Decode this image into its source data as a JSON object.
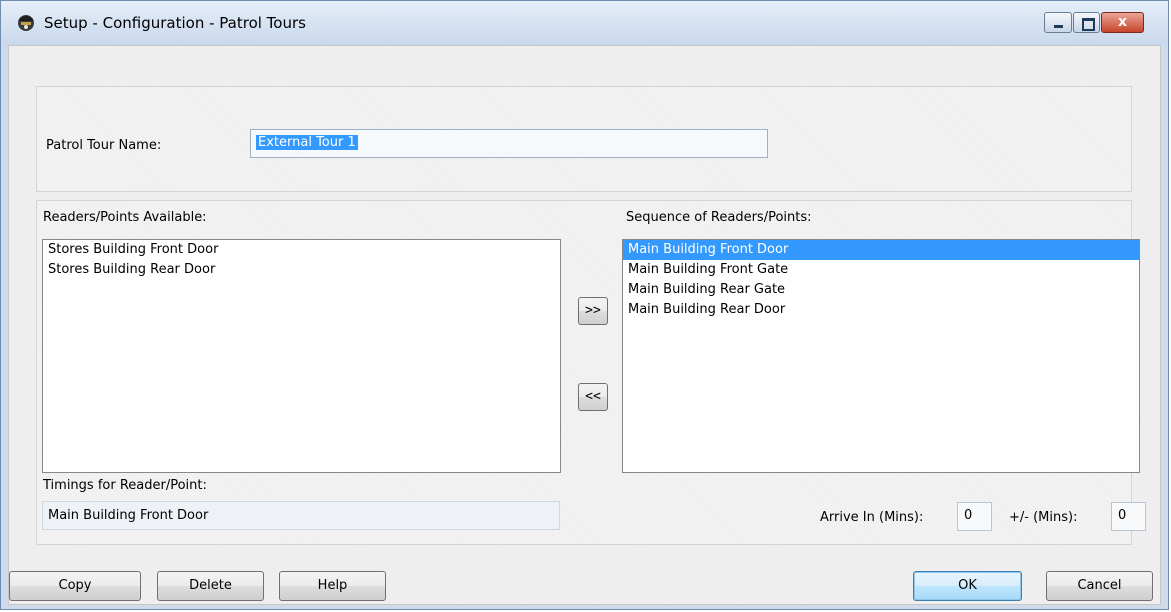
{
  "window": {
    "title": "Setup - Configuration - Patrol Tours",
    "close_glyph": "x"
  },
  "tour": {
    "name_label": "Patrol Tour Name:",
    "name_value": "External Tour 1"
  },
  "available": {
    "label": "Readers/Points Available:",
    "items": [
      "Stores Building Front Door",
      "Stores Building Rear Door"
    ]
  },
  "sequence": {
    "label": "Sequence of Readers/Points:",
    "items": [
      "Main Building Front Door",
      "Main Building Front Gate",
      "Main Building Rear Gate",
      "Main Building Rear Door"
    ],
    "selected_index": 0
  },
  "transfer": {
    "add_label": ">>",
    "remove_label": "<<"
  },
  "timings": {
    "label": "Timings for Reader/Point:",
    "value": "Main Building Front Door",
    "arrive_label": "Arrive In (Mins):",
    "arrive_value": "0",
    "tolerance_label": "+/- (Mins):",
    "tolerance_value": "0"
  },
  "buttons": {
    "copy": "Copy",
    "delete": "Delete",
    "help": "Help",
    "ok": "OK",
    "cancel": "Cancel"
  },
  "colors": {
    "selection": "#3399ff",
    "title_bar": "#c9d8ec",
    "close_button": "#c7452c"
  }
}
